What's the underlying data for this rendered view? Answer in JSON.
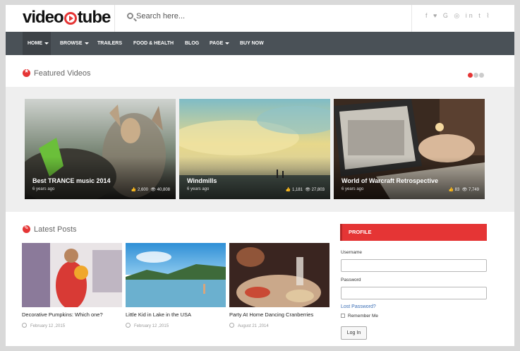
{
  "header": {
    "logo_text_left": "video",
    "logo_text_right": "tube",
    "search_placeholder": "Search here...",
    "social_icons": [
      "facebook-icon",
      "twitter-icon",
      "google-plus-icon",
      "instagram-icon",
      "linkedin-icon",
      "tumblr-icon",
      "rss-icon"
    ],
    "social_glyphs": "f ♥ G+ ◎ in t ⌇"
  },
  "nav": {
    "items": [
      {
        "label": "HOME",
        "dropdown": true,
        "active": true
      },
      {
        "label": "BROWSE",
        "dropdown": true
      },
      {
        "label": "TRAILERS"
      },
      {
        "label": "FOOD & HEALTH"
      },
      {
        "label": "BLOG"
      },
      {
        "label": "PAGE",
        "dropdown": true
      },
      {
        "label": "BUY NOW"
      }
    ]
  },
  "featured": {
    "title": "Featured Videos",
    "slides_count": 3,
    "active_slide": 1,
    "cards": [
      {
        "title": "Best TRANCE music 2014",
        "age": "6 years ago",
        "likes": "2,600",
        "views": "40,808"
      },
      {
        "title": "Windmills",
        "age": "6 years ago",
        "likes": "1,181",
        "views": "27,803"
      },
      {
        "title": "World of Warcraft Retrospective",
        "age": "6 years ago",
        "likes": "83",
        "views": "7,749"
      }
    ]
  },
  "latest": {
    "title": "Latest Posts",
    "posts": [
      {
        "title": "Decorative Pumpkins: Which one?",
        "date": "February 12 ,2015"
      },
      {
        "title": "Little Kid in Lake in the USA",
        "date": "February 12 ,2015"
      },
      {
        "title": "Party At Home Dancing Cranberries",
        "date": "August 21 ,2014"
      }
    ]
  },
  "profile": {
    "heading": "PROFILE",
    "username_label": "Username",
    "password_label": "Password",
    "lost_password": "Lost Password?",
    "remember_me": "Remember Me",
    "login_button": "Log In"
  },
  "colors": {
    "accent": "#e53535",
    "nav_bg": "#4a5157",
    "link": "#3a6eb5"
  }
}
